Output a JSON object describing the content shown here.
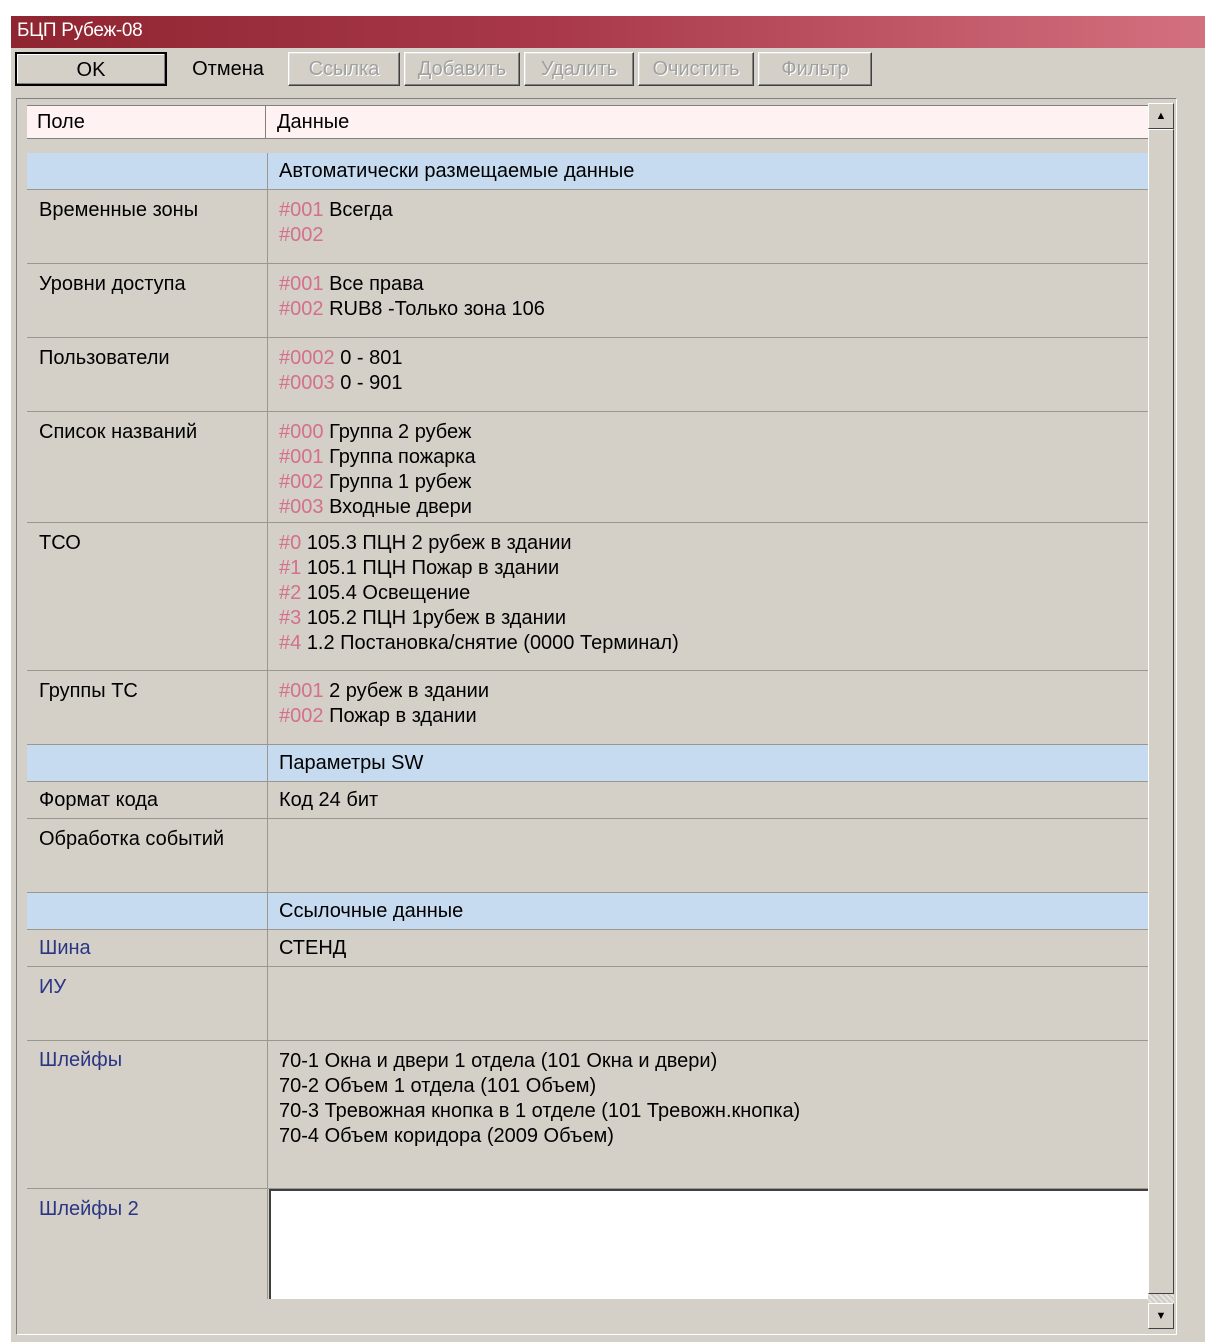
{
  "window": {
    "title": "БЦП Рубеж-08"
  },
  "toolbar": {
    "ok": "OK",
    "cancel": "Отмена",
    "link": "Ссылка",
    "add": "Добавить",
    "delete": "Удалить",
    "clear": "Очистить",
    "filter": "Фильтр"
  },
  "grid": {
    "col_field": "Поле",
    "col_data": "Данные",
    "sections": {
      "auto": "Автоматически размещаемые данные",
      "sw": "Параметры SW",
      "ref": "Ссылочные данные"
    },
    "rows": {
      "time_zones": {
        "label": "Временные зоны",
        "items": [
          {
            "code": "#001",
            "text": "Всегда"
          },
          {
            "code": "#002",
            "text": ""
          }
        ]
      },
      "access_levels": {
        "label": "Уровни доступа",
        "items": [
          {
            "code": "#001",
            "text": "Все права"
          },
          {
            "code": "#002",
            "text": "RUB8 -Только зона 106"
          }
        ]
      },
      "users": {
        "label": "Пользователи",
        "items": [
          {
            "code": "#0002",
            "text": "0 - 801"
          },
          {
            "code": "#0003",
            "text": "0 - 901"
          }
        ]
      },
      "names": {
        "label": "Список названий",
        "items": [
          {
            "code": "#000",
            "text": "Группа 2 рубеж"
          },
          {
            "code": "#001",
            "text": "Группа пожарка"
          },
          {
            "code": "#002",
            "text": "Группа 1 рубеж"
          },
          {
            "code": "#003",
            "text": "Входные двери"
          }
        ]
      },
      "tso": {
        "label": "ТСО",
        "items": [
          {
            "code": "#0",
            "text": "105.3 ПЦН 2 рубеж в здании"
          },
          {
            "code": "#1",
            "text": "105.1 ПЦН Пожар в здании"
          },
          {
            "code": "#2",
            "text": "105.4 Освещение"
          },
          {
            "code": "#3",
            "text": "105.2 ПЦН 1рубеж в здании"
          },
          {
            "code": "#4",
            "text": "1.2 Постановка/снятие (0000 Терминал)"
          }
        ]
      },
      "tc_groups": {
        "label": "Группы ТС",
        "items": [
          {
            "code": "#001",
            "text": "2 рубеж в здании"
          },
          {
            "code": "#002",
            "text": "Пожар в здании"
          }
        ]
      },
      "code_format": {
        "label": "Формат кода",
        "value": "Код 24 бит"
      },
      "event_processing": {
        "label": "Обработка событий",
        "value": ""
      },
      "bus": {
        "label": "Шина",
        "value": "СТЕНД"
      },
      "iu": {
        "label": "ИУ",
        "value": ""
      },
      "loops": {
        "label": "Шлейфы",
        "lines": [
          "70-1 Окна и двери 1 отдела (101 Окна и двери)",
          "70-2 Объем 1 отдела (101 Объем)",
          "70-3 Тревожная кнопка в 1 отделе (101 Тревожн.кнопка)",
          "70-4 Объем коридора (2009 Объем)"
        ]
      },
      "loops2": {
        "label": "Шлейфы 2",
        "value": ""
      }
    }
  },
  "scrollbar": {
    "up_icon": "▲",
    "down_icon": "▼"
  }
}
